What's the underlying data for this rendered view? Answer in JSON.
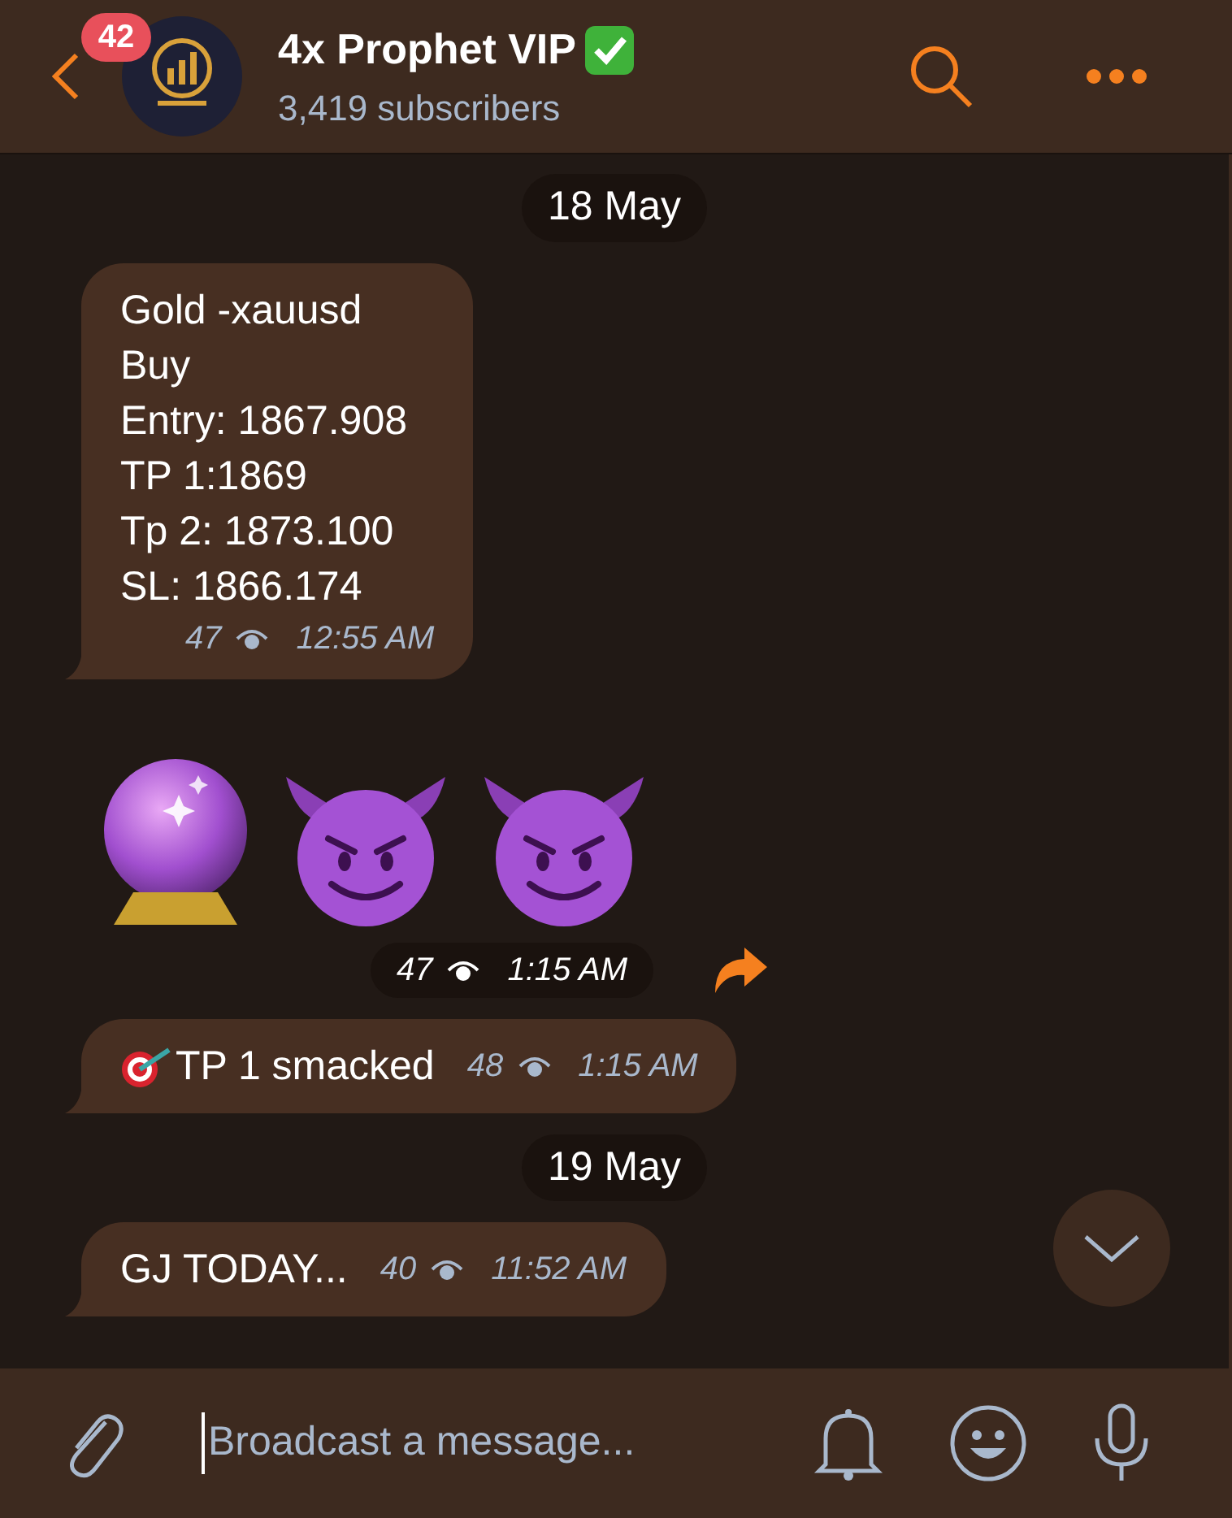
{
  "header": {
    "back_badge": "42",
    "title": "4x Prophet VIP",
    "verified": true,
    "subtitle": "3,419 subscribers"
  },
  "messages": [
    {
      "kind": "date",
      "text": "18 May"
    },
    {
      "kind": "text",
      "lines": [
        "Gold -xauusd",
        "Buy",
        "Entry: 1867.908",
        "TP 1:1869",
        "Tp 2: 1873.100",
        "SL: 1866.174"
      ],
      "views": "47",
      "time": "12:55 AM"
    },
    {
      "kind": "emoji",
      "emojis": [
        {
          "kind": "crystal-ball"
        },
        {
          "kind": "devil"
        },
        {
          "kind": "devil"
        }
      ],
      "views": "47",
      "time": "1:15 AM",
      "forward": true
    },
    {
      "kind": "text",
      "lead": {
        "kind": "target"
      },
      "lines": [
        "TP 1 smacked"
      ],
      "views": "48",
      "time": "1:15 AM"
    },
    {
      "kind": "date",
      "text": "19 May"
    },
    {
      "kind": "text",
      "lines": [
        "GJ TODAY..."
      ],
      "views": "40",
      "time": "11:52 AM"
    }
  ],
  "composer": {
    "placeholder": "Broadcast a message..."
  }
}
